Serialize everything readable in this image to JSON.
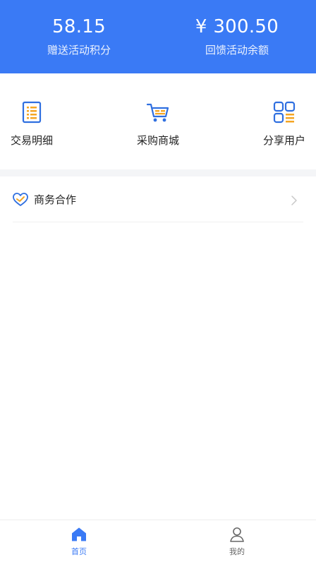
{
  "header": {
    "points": {
      "value": "58.15",
      "label": "赠送活动积分"
    },
    "balance": {
      "value": "¥ 300.50",
      "label": "回馈活动余额"
    }
  },
  "grid": [
    {
      "label": "交易明细",
      "icon": "list-icon"
    },
    {
      "label": "采购商城",
      "icon": "cart-icon"
    },
    {
      "label": "分享用户",
      "icon": "apps-grid-icon"
    }
  ],
  "menu": {
    "business": {
      "label": "商务合作",
      "icon": "heart-handshake-icon"
    }
  },
  "tabbar": {
    "home": {
      "label": "首页",
      "icon": "home-icon"
    },
    "mine": {
      "label": "我的",
      "icon": "user-icon"
    }
  },
  "colors": {
    "primary": "#3a7af5",
    "accent": "#f5a623",
    "icon_blue": "#2f6fe0"
  }
}
